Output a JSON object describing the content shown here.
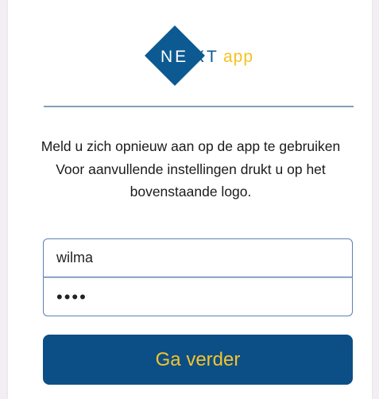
{
  "logo": {
    "text_ne": "NE",
    "text_xt": "XT",
    "text_app": "app",
    "brand_color": "#0d5a92",
    "accent_color": "#f4c21f"
  },
  "message": {
    "line1": "Meld u zich opnieuw aan op de app te gebruiken",
    "line2": "Voor aanvullende instellingen drukt u op het bovenstaande logo."
  },
  "login": {
    "username_value": "wilma",
    "password_value": "1234"
  },
  "continue_button": {
    "label": "Ga verder",
    "bg_color": "#0c4f86",
    "text_color": "#f5c32e"
  }
}
